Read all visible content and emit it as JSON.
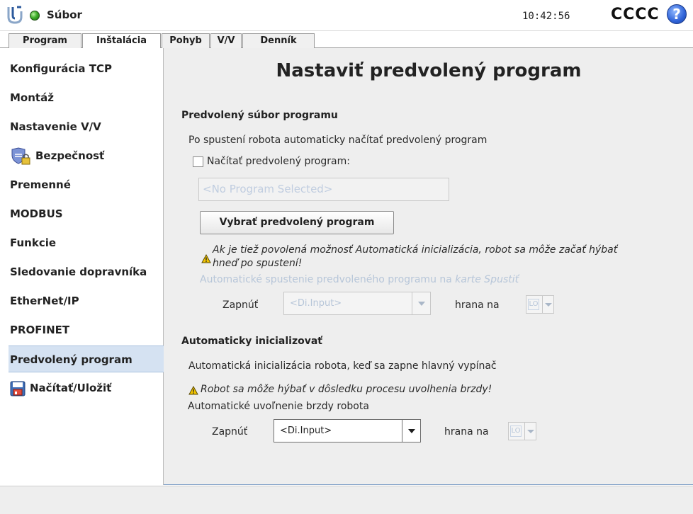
{
  "header": {
    "file_label": "Súbor",
    "clock": "10:42:56",
    "robot_name": "CCCC",
    "help_icon": "question-circle-icon",
    "status_color": "#3fae2a"
  },
  "tabs": [
    {
      "label": "Program"
    },
    {
      "label": "Inštalácia"
    },
    {
      "label": "Pohyb"
    },
    {
      "label": "V/V"
    },
    {
      "label": "Denník"
    }
  ],
  "active_tab": "Inštalácia",
  "sidebar": {
    "items": [
      {
        "label": "Konfigurácia TCP"
      },
      {
        "label": "Montáž"
      },
      {
        "label": "Nastavenie V/V"
      },
      {
        "label": "Bezpečnosť",
        "icon": "safety-shield-lock-icon"
      },
      {
        "label": "Premenné"
      },
      {
        "label": "MODBUS"
      },
      {
        "label": "Funkcie"
      },
      {
        "label": "Sledovanie dopravníka"
      },
      {
        "label": "EtherNet/IP"
      },
      {
        "label": "PROFINET"
      },
      {
        "label": "Predvolený program"
      },
      {
        "label": "Načítať/Uložiť",
        "icon": "floppy-disk-icon"
      }
    ],
    "active": "Predvolený program"
  },
  "main": {
    "title": "Nastaviť predvolený program",
    "default_program": {
      "heading": "Predvolený súbor programu",
      "description": "Po spustení robota automaticky načítať predvolený program",
      "checkbox_label": "Načítať predvolený program:",
      "checkbox_checked": false,
      "program_field": "<No Program Selected>",
      "select_button": "Vybrať predvolený program",
      "warning_line1": "Ak je tiež povolená možnosť Automatická inicializácia, robot sa môže začať hýbať",
      "warning_line2": "hneď po spustení!",
      "autostart_prefix": "Automatické spustenie predvoleného programu na ",
      "autostart_tab": "karte Spustiť",
      "enable_label": "Zapnúť",
      "input_value": "<Di.Input>",
      "edge_label": "hrana na",
      "edge_value": "LO"
    },
    "auto_init": {
      "heading": "Automaticky inicializovať",
      "description": "Automatická inicializácia robota, keď sa zapne hlavný vypínač",
      "warning": "Robot sa môže hýbať v dôsledku procesu uvolhenia brzdy!",
      "brake_label": "Automatické uvoľnenie brzdy robota",
      "enable_label": "Zapnúť",
      "input_value": "<Di.Input>",
      "edge_label": "hrana na",
      "edge_value": "LO"
    }
  }
}
